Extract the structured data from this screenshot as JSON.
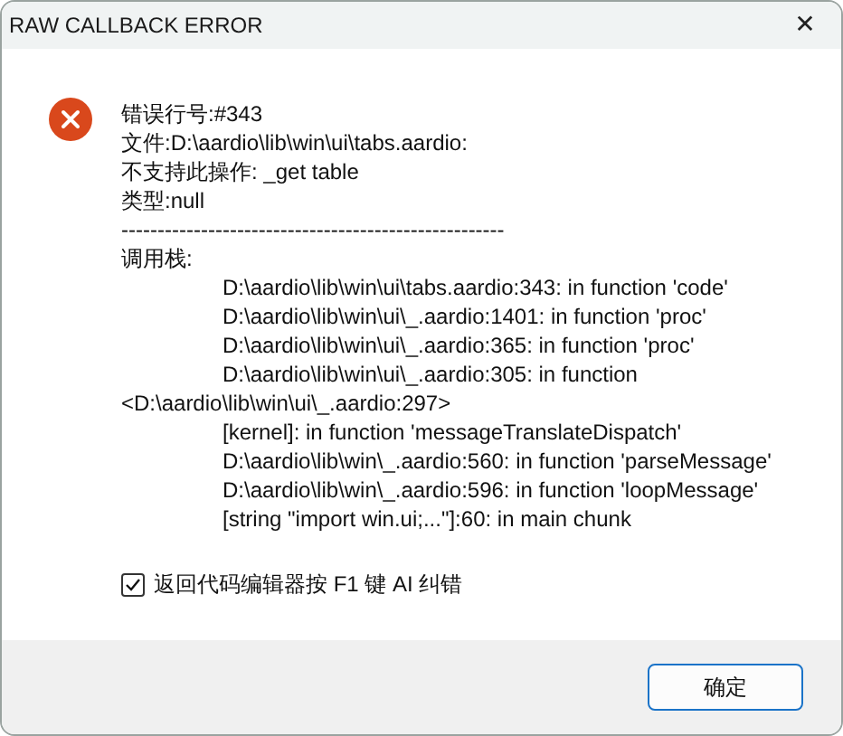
{
  "window": {
    "title": "RAW CALLBACK ERROR",
    "close": "✕"
  },
  "message": {
    "lines": [
      {
        "kind": "plain",
        "text": "错误行号:#343"
      },
      {
        "kind": "plain",
        "text": "文件:D:\\aardio\\lib\\win\\ui\\tabs.aardio:"
      },
      {
        "kind": "plain",
        "text": "不支持此操作: _get table"
      },
      {
        "kind": "plain",
        "text": "类型:null"
      },
      {
        "kind": "plain",
        "text": "-----------------------------------------------------"
      },
      {
        "kind": "plain",
        "text": "调用栈:"
      },
      {
        "kind": "indent",
        "text": "D:\\aardio\\lib\\win\\ui\\tabs.aardio:343: in function 'code'"
      },
      {
        "kind": "indent",
        "text": "D:\\aardio\\lib\\win\\ui\\_.aardio:1401: in function 'proc'"
      },
      {
        "kind": "indent",
        "text": "D:\\aardio\\lib\\win\\ui\\_.aardio:365: in function 'proc'"
      },
      {
        "kind": "indent",
        "text": "D:\\aardio\\lib\\win\\ui\\_.aardio:305: in function"
      },
      {
        "kind": "plain",
        "text": "<D:\\aardio\\lib\\win\\ui\\_.aardio:297>"
      },
      {
        "kind": "indent",
        "text": "[kernel]: in function 'messageTranslateDispatch'"
      },
      {
        "kind": "indent",
        "text": "D:\\aardio\\lib\\win\\_.aardio:560: in function 'parseMessage'"
      },
      {
        "kind": "indent",
        "text": "D:\\aardio\\lib\\win\\_.aardio:596: in function 'loopMessage'"
      },
      {
        "kind": "indent",
        "text": "[string \"import win.ui;...\"]:60: in main chunk"
      }
    ]
  },
  "checkbox": {
    "label": "返回代码编辑器按 F1 键 AI 纠错",
    "checked": true
  },
  "buttons": [
    "确定"
  ]
}
